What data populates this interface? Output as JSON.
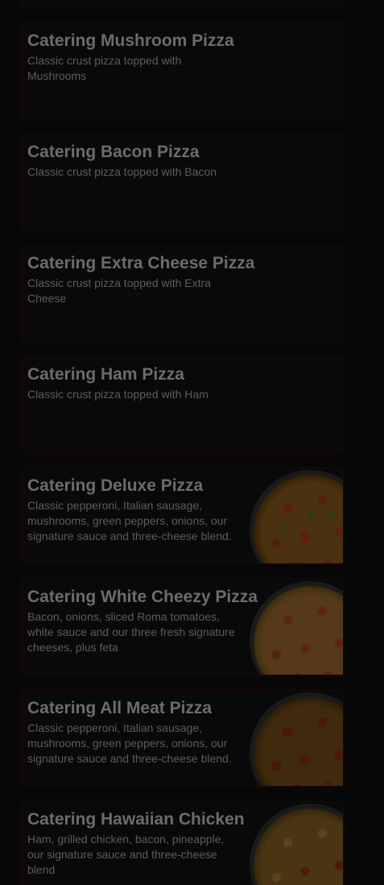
{
  "menu": {
    "items": [
      {
        "title": "Catering Mushroom Pizza",
        "description": "Classic crust pizza topped with Mushrooms",
        "has_image": false
      },
      {
        "title": "Catering Bacon Pizza",
        "description": "Classic crust pizza topped with Bacon",
        "has_image": false
      },
      {
        "title": "Catering Extra Cheese Pizza",
        "description": "Classic crust pizza topped with Extra Cheese",
        "has_image": false
      },
      {
        "title": "Catering Ham Pizza",
        "description": "Classic crust pizza topped with Ham",
        "has_image": false
      },
      {
        "title": "Catering Deluxe Pizza",
        "description": "Classic pepperoni, Italian sausage, mushrooms, green peppers, onions, our signature sauce and three-cheese blend.",
        "has_image": true,
        "image_icon": "deluxe-pizza-photo"
      },
      {
        "title": "Catering White Cheezy Pizza",
        "description": "Bacon, onions, sliced Roma tomatoes, white sauce and our three fresh signature cheeses, plus feta",
        "has_image": true,
        "image_icon": "white-cheezy-pizza-photo"
      },
      {
        "title": "Catering All Meat Pizza",
        "description": "Classic pepperoni, Italian sausage, mushrooms, green peppers, onions, our signature sauce and three-cheese blend.",
        "has_image": true,
        "image_icon": "all-meat-pizza-photo"
      },
      {
        "title": "Catering Hawaiian Chicken",
        "description": "Ham, grilled chicken, bacon, pineapple, our signature sauce and three-cheese blend",
        "has_image": true,
        "image_icon": "hawaiian-chicken-pizza-photo"
      }
    ]
  },
  "colors": {
    "overlay_background": "#070707",
    "card_background": "#090909",
    "card_border": "#1f0707",
    "title_text": "#6c6c6c",
    "description_text": "#5c5c5c"
  }
}
